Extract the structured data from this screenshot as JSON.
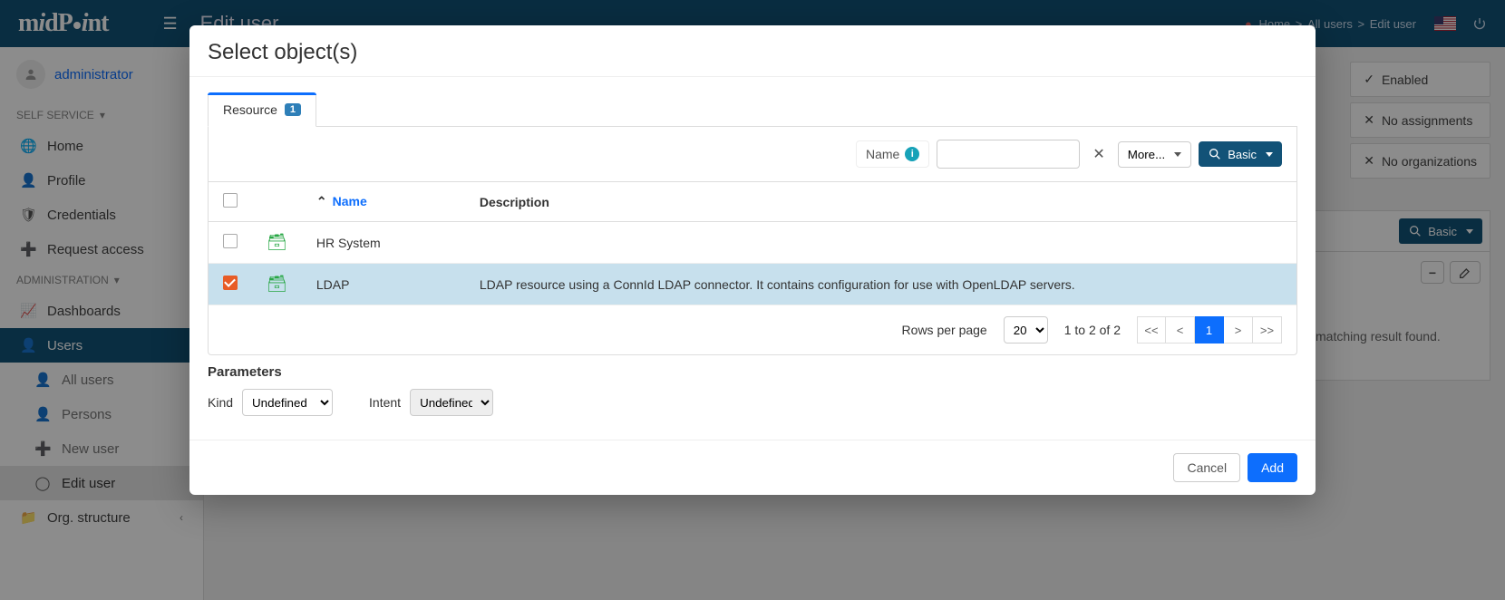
{
  "header": {
    "app_name": "midPoint",
    "page_title": "Edit user",
    "breadcrumbs": [
      "Home",
      "All users",
      "Edit user"
    ]
  },
  "current_user": "administrator",
  "nav": {
    "section_self": "SELF SERVICE",
    "self": [
      {
        "label": "Home"
      },
      {
        "label": "Profile"
      },
      {
        "label": "Credentials"
      },
      {
        "label": "Request access"
      }
    ],
    "section_admin": "ADMINISTRATION",
    "admin": [
      {
        "label": "Dashboards"
      },
      {
        "label": "Users",
        "active": true
      },
      {
        "label": "All users",
        "sub": true
      },
      {
        "label": "Persons",
        "sub": true
      },
      {
        "label": "New user",
        "sub": true
      },
      {
        "label": "Edit user",
        "sub": true,
        "current": true
      },
      {
        "label": "Org. structure"
      }
    ]
  },
  "side_cards": {
    "enabled": "Enabled",
    "no_assign": "No assignments",
    "no_orgs": "No organizations",
    "basic_btn": "Basic",
    "no_result": "No matching result found."
  },
  "modal": {
    "title": "Select object(s)",
    "tab_label": "Resource",
    "tab_badge": "1",
    "search": {
      "name_label": "Name",
      "more_label": "More...",
      "basic_label": "Basic"
    },
    "columns": {
      "name": "Name",
      "description": "Description"
    },
    "rows": [
      {
        "name": "HR System",
        "description": "",
        "selected": false
      },
      {
        "name": "LDAP",
        "description": "LDAP resource using a ConnId LDAP connector. It contains configuration for use with OpenLDAP servers.",
        "selected": true
      }
    ],
    "footer": {
      "rows_per_page_label": "Rows per page",
      "rows_per_page_value": "20",
      "range_text": "1 to 2 of 2",
      "pager": {
        "first": "<<",
        "prev": "<",
        "current": "1",
        "next": ">",
        "last": ">>"
      }
    },
    "params": {
      "heading": "Parameters",
      "kind_label": "Kind",
      "kind_value": "Undefined",
      "intent_label": "Intent",
      "intent_value": "Undefined"
    },
    "buttons": {
      "cancel": "Cancel",
      "add": "Add"
    }
  }
}
